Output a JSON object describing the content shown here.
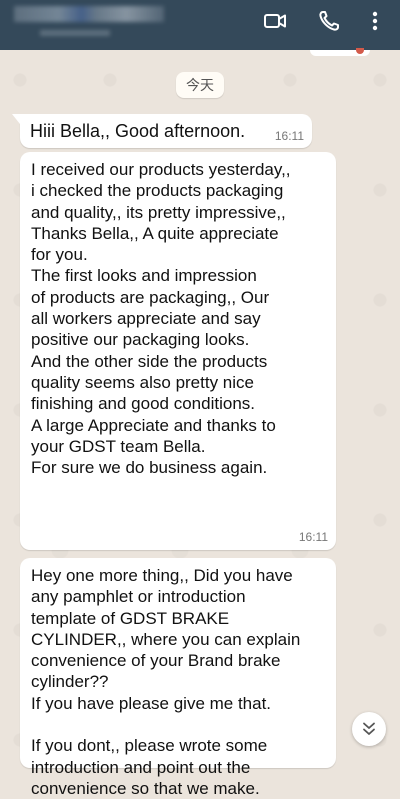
{
  "header": {
    "icons": [
      "video-call-icon",
      "voice-call-icon",
      "more-options-icon"
    ],
    "background": "#34495a"
  },
  "chat": {
    "date_label": "今天",
    "messages": [
      {
        "lines": [
          "Hiii Bella,, Good afternoon."
        ],
        "time": "16:11"
      },
      {
        "lines": [
          "I received our products yesterday,,",
          "i checked the products packaging",
          "and quality,, its pretty impressive,,",
          "Thanks Bella,, A quite appreciate",
          "for you.",
          "The first looks and impression",
          "of products are packaging,,  Our",
          "all workers appreciate and say",
          "positive our packaging looks.",
          "And the other side the products",
          "quality seems also pretty nice",
          "finishing and good conditions.",
          "A large Appreciate and thanks to",
          "your GDST team Bella.",
          "For sure we do business again."
        ],
        "time": "16:11"
      },
      {
        "lines": [
          "Hey one more thing,, Did you have",
          "any pamphlet or introduction",
          "template of GDST BRAKE",
          "CYLINDER,, where you can explain",
          "convenience of your Brand brake",
          "cylinder??",
          "If you have please give me that.",
          "",
          "If you dont,, please wrote some",
          "introduction and point out the",
          "convenience so that we make."
        ],
        "time": ""
      }
    ]
  },
  "scroll_button": {
    "icon": "double-chevron-down-icon"
  },
  "colors": {
    "bubble": "#ffffff",
    "chat_bg": "#ebe4dc",
    "timestamp": "#777777"
  }
}
